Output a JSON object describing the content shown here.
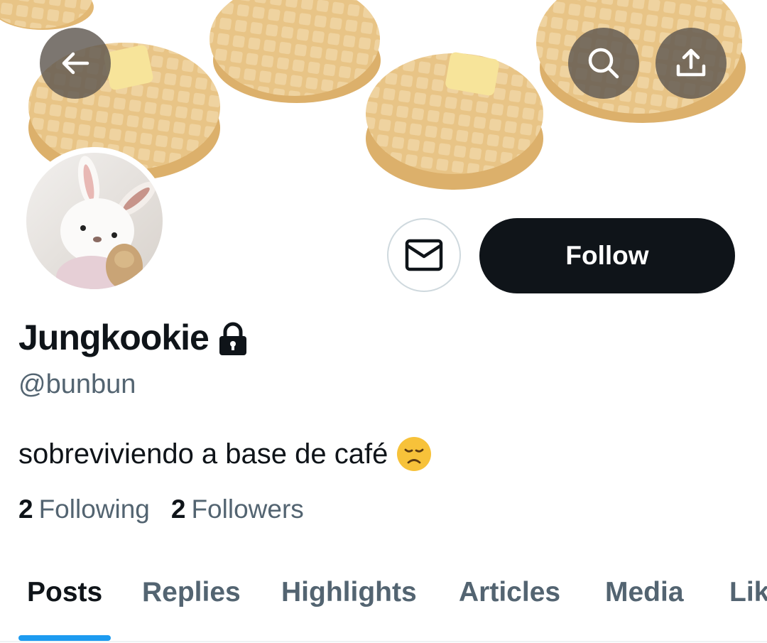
{
  "header": {
    "back_icon": "arrow-left-icon",
    "search_icon": "search-icon",
    "share_icon": "share-upload-icon",
    "banner_description": "waffles"
  },
  "profile": {
    "display_name": "Jungkookie",
    "protected_icon": "lock-icon",
    "handle": "@bunbun",
    "bio_text": "sobreviviendo a base de café",
    "bio_emoji": "disappointed-face-emoji",
    "following_count": "2",
    "following_label": "Following",
    "followers_count": "2",
    "followers_label": "Followers"
  },
  "actions": {
    "message_icon": "envelope-icon",
    "follow_label": "Follow"
  },
  "tabs": [
    {
      "label": "Posts",
      "active": true
    },
    {
      "label": "Replies",
      "active": false
    },
    {
      "label": "Highlights",
      "active": false
    },
    {
      "label": "Articles",
      "active": false
    },
    {
      "label": "Media",
      "active": false
    },
    {
      "label": "Lik",
      "active": false
    }
  ],
  "colors": {
    "accent": "#1d9bf0",
    "text_primary": "#0f1419",
    "text_secondary": "#536471",
    "follow_button_bg": "#0f1419"
  }
}
